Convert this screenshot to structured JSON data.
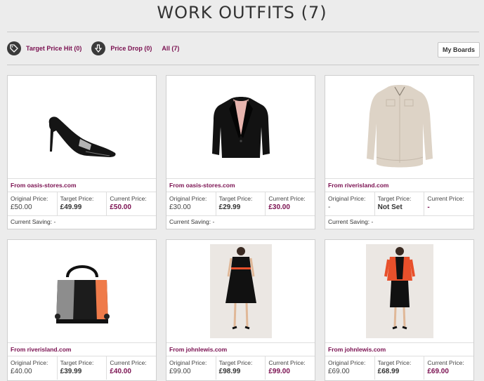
{
  "header": {
    "title": "WORK OUTFITS (7)"
  },
  "filters": [
    {
      "label": "Target Price Hit (0)",
      "icon": "tag-icon"
    },
    {
      "label": "Price Drop (0)",
      "icon": "arrow-down-icon"
    },
    {
      "label": "All (7)"
    }
  ],
  "toolbar": {
    "boards_label": "My Boards"
  },
  "labels": {
    "original": "Original Price:",
    "target": "Target Price:",
    "current": "Current Price:",
    "saving": "Current Saving:"
  },
  "products": [
    {
      "source": "From oasis-stores.com",
      "original": "£50.00",
      "target": "£49.99",
      "current": "£50.00",
      "saving": "-",
      "image": "black-court-shoe"
    },
    {
      "source": "From oasis-stores.com",
      "original": "£30.00",
      "target": "£29.99",
      "current": "£30.00",
      "saving": "-",
      "image": "black-blazer"
    },
    {
      "source": "From riverisland.com",
      "original": "-",
      "target": "Not Set",
      "current": "-",
      "saving": "-",
      "image": "cream-blouse"
    },
    {
      "source": "From riverisland.com",
      "original": "£40.00",
      "target": "£39.99",
      "current": "£40.00",
      "image": "colour-block-handbag"
    },
    {
      "source": "From johnlewis.com",
      "original": "£99.00",
      "target": "£98.99",
      "current": "£99.00",
      "image": "black-dress"
    },
    {
      "source": "From johnlewis.com",
      "original": "£69.00",
      "target": "£68.99",
      "current": "£69.00",
      "image": "orange-jacket-outfit"
    }
  ],
  "colors": {
    "accent": "#7a1050",
    "background": "#ececec",
    "border": "#cfcfcf"
  }
}
